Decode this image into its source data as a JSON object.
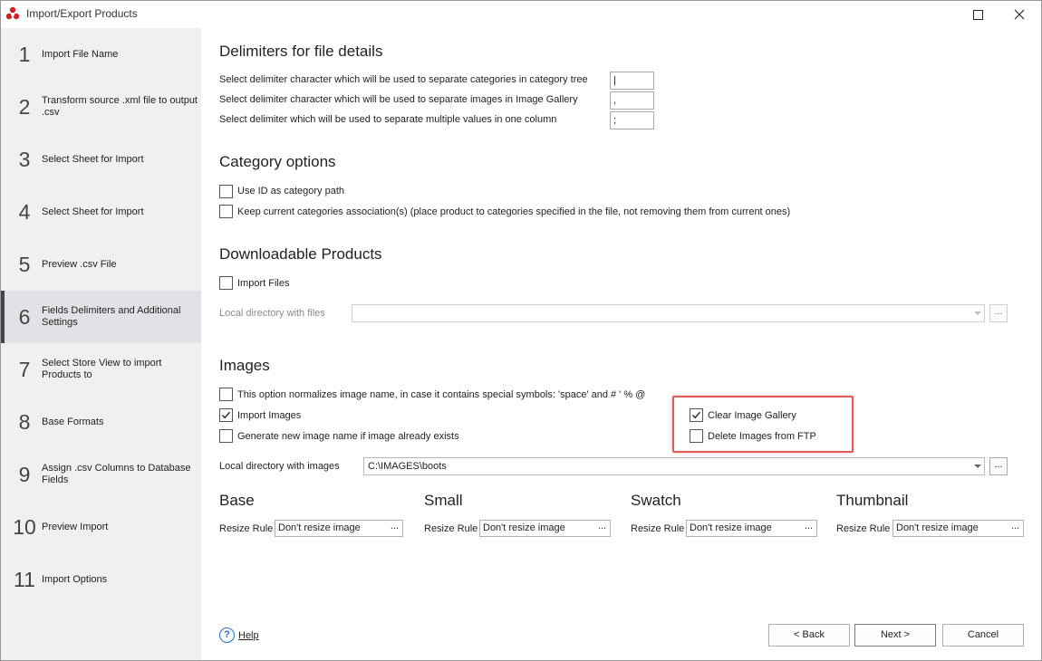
{
  "window": {
    "title": "Import/Export Products",
    "maximize_icon": "maximize-icon",
    "close_icon": "close-icon",
    "app_icon": "app-logo-icon",
    "accent_color": "#d02020"
  },
  "sidebar": {
    "steps": [
      {
        "num": "1",
        "label": "Import File Name"
      },
      {
        "num": "2",
        "label": "Transform source .xml file to output .csv"
      },
      {
        "num": "3",
        "label": "Select Sheet for Import"
      },
      {
        "num": "4",
        "label": "Select Sheet for Import"
      },
      {
        "num": "5",
        "label": "Preview .csv File"
      },
      {
        "num": "6",
        "label": "Fields Delimiters and Additional Settings"
      },
      {
        "num": "7",
        "label": "Select Store View to import Products to"
      },
      {
        "num": "8",
        "label": "Base Formats"
      },
      {
        "num": "9",
        "label": "Assign .csv Columns to Database Fields"
      },
      {
        "num": "10",
        "label": "Preview Import"
      },
      {
        "num": "11",
        "label": "Import Options"
      }
    ],
    "active_step": "6"
  },
  "delimiters": {
    "title": "Delimiters for file details",
    "rows": [
      {
        "label": "Select delimiter character which will be used to separate categories in category tree",
        "value": "|"
      },
      {
        "label": "Select delimiter character which will be used to separate images in Image Gallery",
        "value": ","
      },
      {
        "label": "Select delimiter which will be used to separate multiple values in one column",
        "value": ";"
      }
    ]
  },
  "category_options": {
    "title": "Category options",
    "use_id": {
      "label": "Use ID as category path",
      "checked": false
    },
    "keep_current": {
      "label": "Keep current categories association(s) (place product to categories specified in the file, not removing them from current ones)",
      "checked": false
    }
  },
  "downloadable": {
    "title": "Downloadable Products",
    "import_files": {
      "label": "Import Files",
      "checked": false
    },
    "local_dir_label": "Local directory with files",
    "local_dir_value": "",
    "browse_label": "..."
  },
  "images": {
    "title": "Images",
    "normalize": {
      "label": "This option normalizes image name, in case it contains special symbols: 'space' and # ' % @",
      "checked": false
    },
    "import_images": {
      "label": "Import Images",
      "checked": true
    },
    "generate_new": {
      "label": "Generate new image name if image already exists",
      "checked": false
    },
    "clear_gallery": {
      "label": "Clear Image Gallery",
      "checked": true
    },
    "delete_ftp": {
      "label": "Delete Images from FTP",
      "checked": false
    },
    "local_dir_label": "Local directory with images",
    "local_dir_value": "C:\\IMAGES\\boots",
    "browse_label": "..."
  },
  "resize": {
    "rule_label": "Resize Rule",
    "columns": [
      {
        "title": "Base",
        "value": "Don't resize image"
      },
      {
        "title": "Small",
        "value": "Don't resize image"
      },
      {
        "title": "Swatch",
        "value": "Don't resize image"
      },
      {
        "title": "Thumbnail",
        "value": "Don't resize image"
      }
    ],
    "dots": "..."
  },
  "footer": {
    "help_icon": "help-icon",
    "help_glyph": "?",
    "help": "Help",
    "back": "< Back",
    "next": "Next >",
    "cancel": "Cancel"
  }
}
